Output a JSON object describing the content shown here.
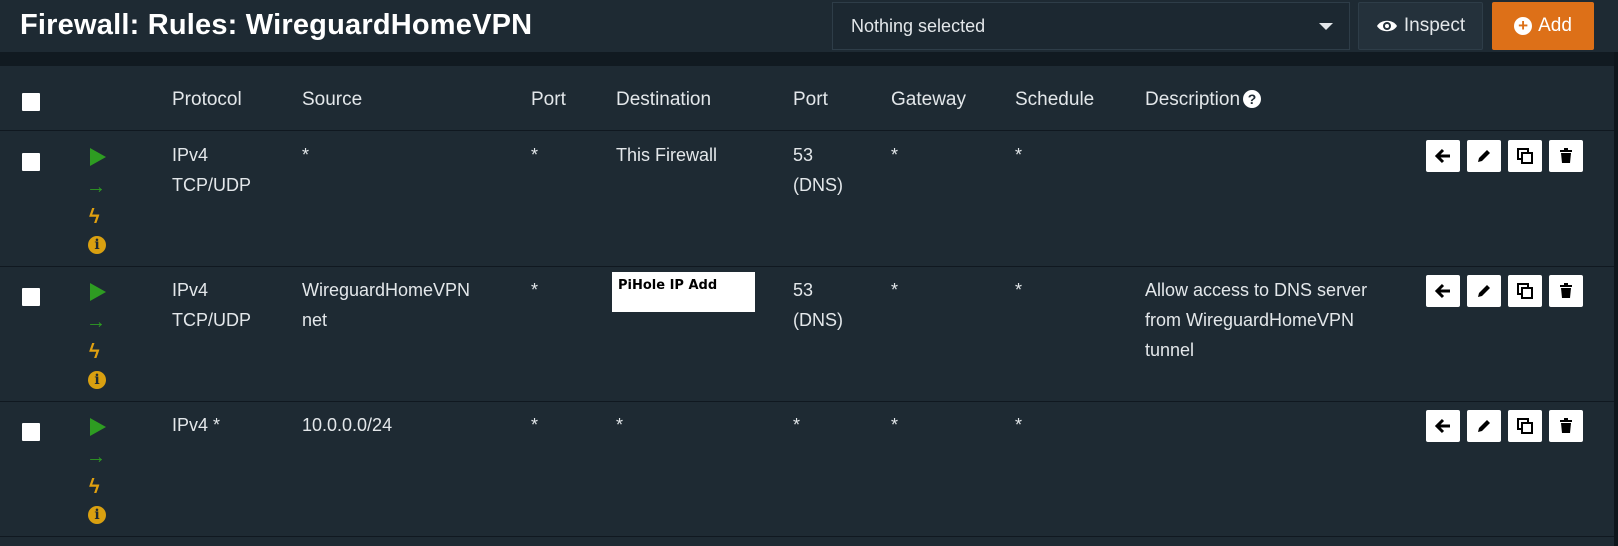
{
  "header": {
    "title": "Firewall: Rules: WireguardHomeVPN",
    "select_value": "Nothing selected",
    "inspect_label": "Inspect",
    "add_label": "Add"
  },
  "table": {
    "columns": {
      "protocol": "Protocol",
      "source": "Source",
      "port": "Port",
      "destination": "Destination",
      "dest_port": "Port",
      "gateway": "Gateway",
      "schedule": "Schedule",
      "description": "Description"
    },
    "rows": [
      {
        "protocol_line1": "IPv4",
        "protocol_line2": "TCP/UDP",
        "source_line1": "*",
        "source_line2": "",
        "port": "*",
        "destination": "This Firewall",
        "dest_port_line1": "53",
        "dest_port_line2": "(DNS)",
        "gateway": "*",
        "schedule": "*",
        "description_line1": "",
        "description_line2": "",
        "description_line3": ""
      },
      {
        "protocol_line1": "IPv4",
        "protocol_line2": "TCP/UDP",
        "source_line1": "WireguardHomeVPN",
        "source_line2": "net",
        "port": "*",
        "destination": "PiHole IP Add",
        "dest_port_line1": "53",
        "dest_port_line2": "(DNS)",
        "gateway": "*",
        "schedule": "*",
        "description_line1": "Allow access to DNS server",
        "description_line2": "from WireguardHomeVPN",
        "description_line3": "tunnel"
      },
      {
        "protocol_line1": "IPv4 *",
        "protocol_line2": "",
        "source_line1": "10.0.0.0/24",
        "source_line2": "",
        "port": "*",
        "destination": "*",
        "dest_port_line1": "*",
        "dest_port_line2": "",
        "gateway": "*",
        "schedule": "*",
        "description_line1": "",
        "description_line2": "",
        "description_line3": ""
      }
    ]
  },
  "icons": {
    "status": [
      "play-icon",
      "arrow-right-icon",
      "bolt-icon",
      "info-icon"
    ],
    "actions": [
      "arrow-left-icon",
      "pencil-icon",
      "copy-icon",
      "trash-icon"
    ]
  },
  "colors": {
    "background": "#1e2a33",
    "accent_add": "#dd7018",
    "pass_green": "#2e9c22",
    "warn_yellow": "#d9a010"
  }
}
